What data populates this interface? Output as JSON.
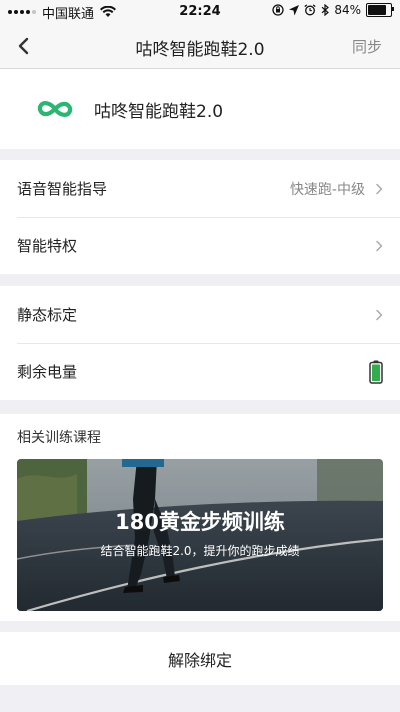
{
  "status_bar": {
    "carrier": "中国联通",
    "time": "22:24",
    "battery_percent": "84%",
    "icons": [
      "signal-dots-icon",
      "wifi-icon",
      "orientation-lock-icon",
      "location-icon",
      "alarm-icon",
      "bluetooth-icon",
      "battery-icon"
    ]
  },
  "nav": {
    "title": "咕咚智能跑鞋2.0",
    "action": "同步",
    "back_icon": "chevron-left-icon"
  },
  "device": {
    "name": "咕咚智能跑鞋2.0",
    "logo_icon": "infinity-logo-icon",
    "logo_color": "#2bb673"
  },
  "settings": {
    "voice_guide": {
      "label": "语音智能指导",
      "value": "快速跑-中级"
    },
    "privilege": {
      "label": "智能特权"
    },
    "calibration": {
      "label": "静态标定"
    },
    "battery": {
      "label": "剩余电量",
      "icon": "battery-full-icon",
      "color": "#2fae4a"
    }
  },
  "courses": {
    "section_title": "相关训练课程",
    "card": {
      "title": "180黄金步频训练",
      "subtitle": "结合智能跑鞋2.0，提升你的跑步成绩"
    }
  },
  "unbind_label": "解除绑定"
}
